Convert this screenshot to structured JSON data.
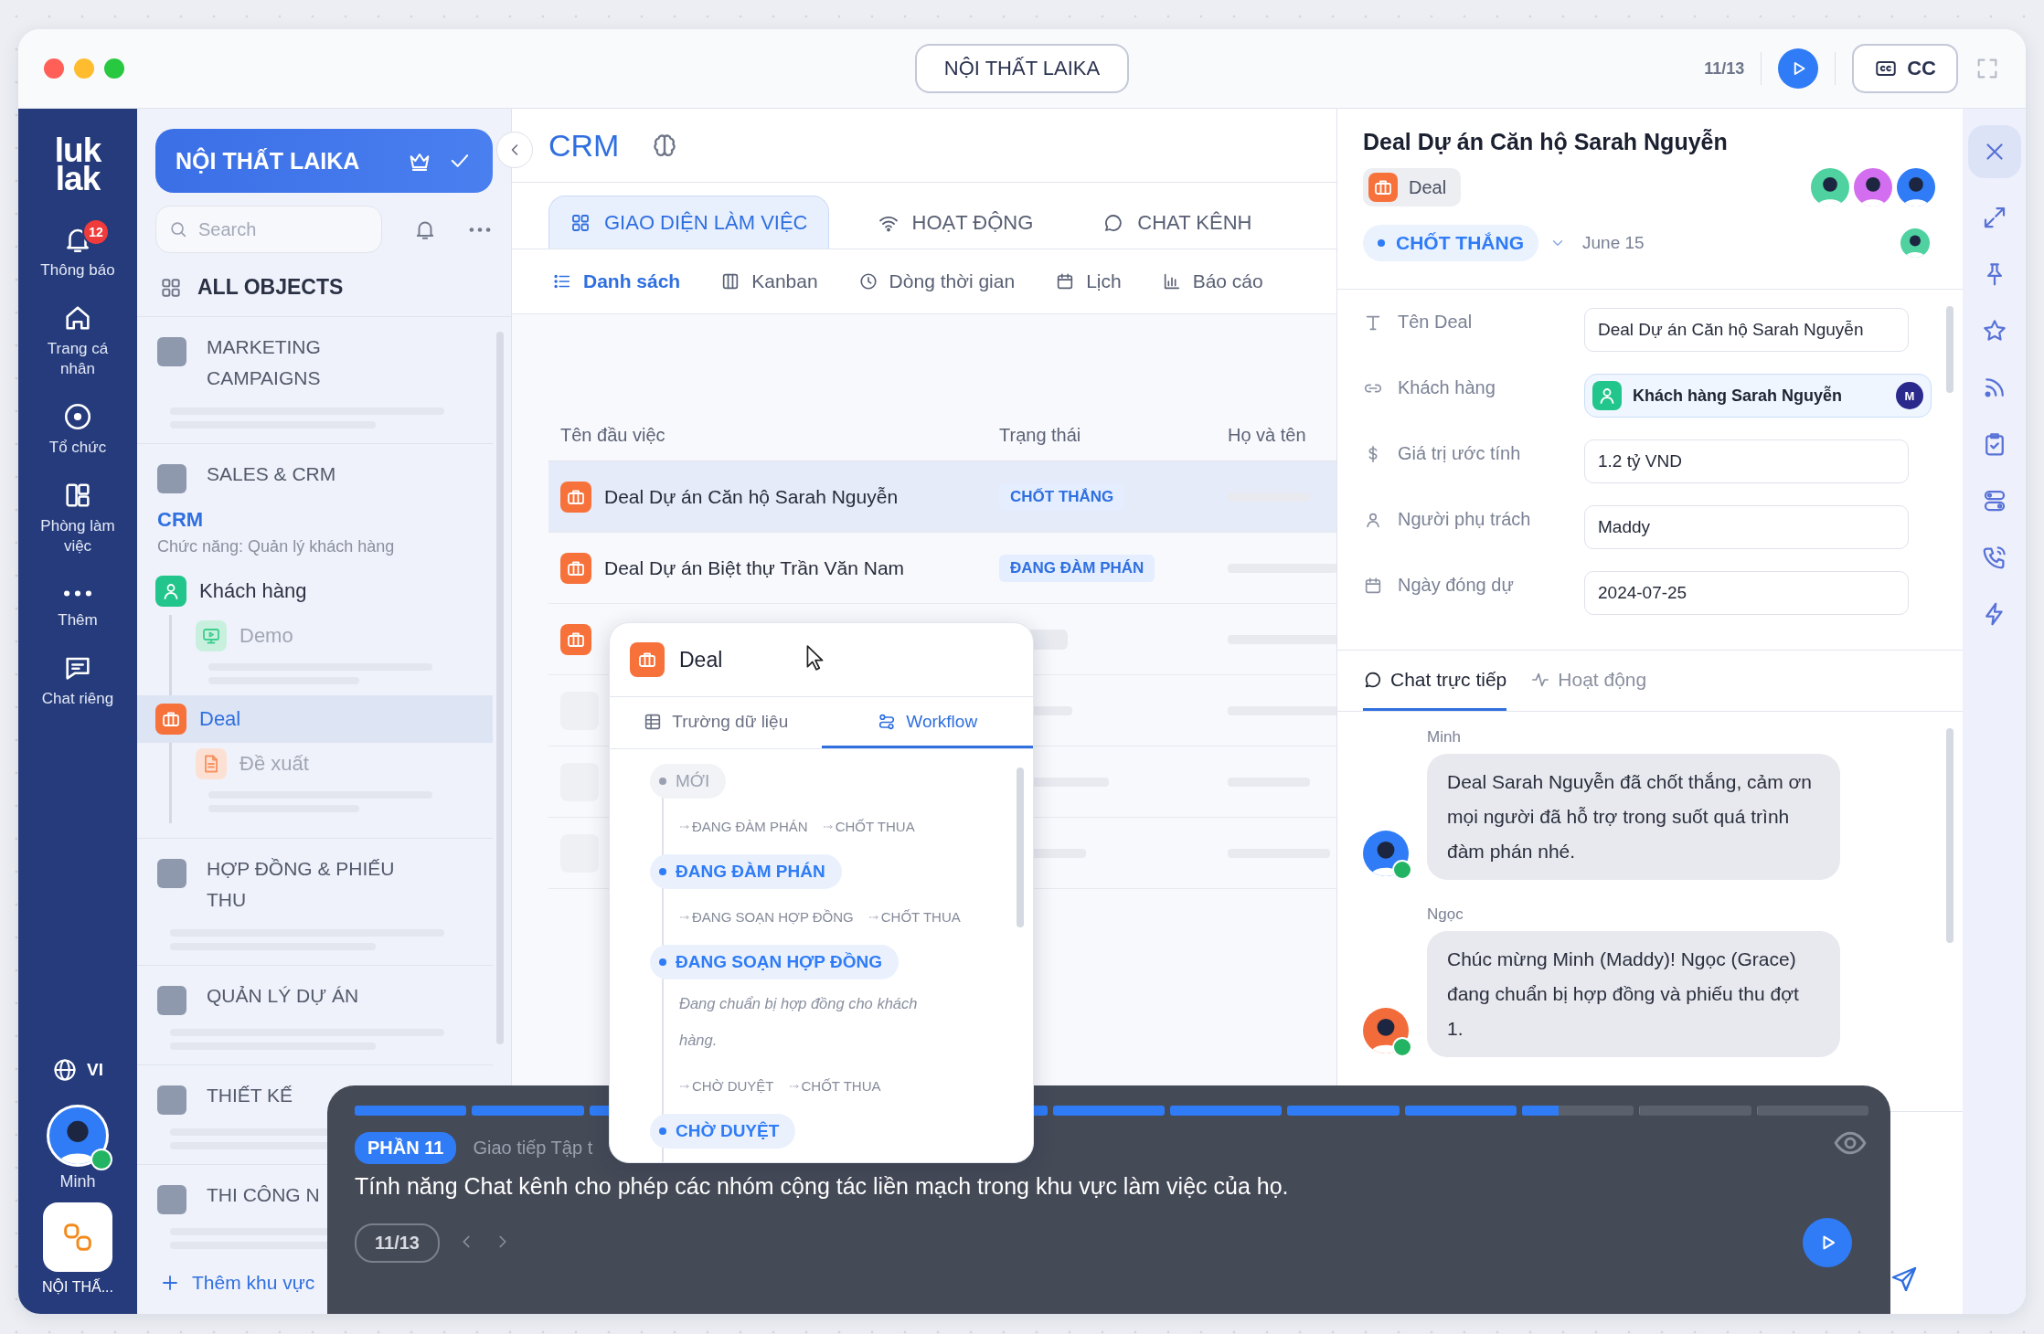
{
  "window": {
    "title": "NỘI THẤT LAIKA",
    "step": "11/13",
    "cc_label": "CC"
  },
  "rail": {
    "logo": [
      "luk",
      "lak"
    ],
    "items": [
      {
        "kind": "bell",
        "label": "Thông báo",
        "badge": "12"
      },
      {
        "kind": "home",
        "label": "Trang cá nhân"
      },
      {
        "kind": "target",
        "label": "Tổ chức"
      },
      {
        "kind": "layout",
        "label": "Phòng làm việc"
      },
      {
        "kind": "dots",
        "label": "Thêm"
      },
      {
        "kind": "chat",
        "label": "Chat riêng"
      }
    ],
    "language": "VI",
    "user": {
      "name": "Minh",
      "online": true,
      "color": "#2f7cf6"
    },
    "app": {
      "label": "NỘI THẤ..."
    }
  },
  "sidebar": {
    "workspace": "NỘI THẤT LAIKA",
    "search": {
      "placeholder": "Search"
    },
    "all_objects": "ALL OBJECTS",
    "sections": [
      {
        "title": "MARKETING CAMPAIGNS"
      },
      {
        "title": "SALES & CRM",
        "module": {
          "name": "CRM",
          "description": "Chức năng: Quản lý khách hàng",
          "objects": [
            {
              "name": "Khách hàng",
              "kind": "customer",
              "selected": false,
              "children": [
                {
                  "name": "Demo",
                  "kind": "demo",
                  "selected": false
                }
              ]
            },
            {
              "name": "Deal",
              "kind": "deal",
              "selected": true,
              "children": [
                {
                  "name": "Đề xuất",
                  "kind": "proposal",
                  "selected": false
                }
              ]
            }
          ]
        }
      },
      {
        "title": "HỢP ĐỒNG & PHIẾU THU"
      },
      {
        "title": "QUẢN LÝ DỰ ÁN"
      },
      {
        "title": "THIẾT KẾ"
      },
      {
        "title": "THI CÔNG N"
      }
    ],
    "add_label": "Thêm khu vực"
  },
  "main": {
    "title": "CRM",
    "tabs": [
      {
        "label": "GIAO DIỆN LÀM VIỆC",
        "kind": "grid",
        "selected": true
      },
      {
        "label": "HOẠT ĐỘNG",
        "kind": "wifi",
        "selected": false
      },
      {
        "label": "CHAT KÊNH",
        "kind": "bubble",
        "selected": false
      }
    ],
    "views": [
      {
        "label": "Danh sách",
        "kind": "list",
        "selected": true
      },
      {
        "label": "Kanban",
        "kind": "kanban",
        "selected": false
      },
      {
        "label": "Dòng thời gian",
        "kind": "clock",
        "selected": false
      },
      {
        "label": "Lịch",
        "kind": "calendar",
        "selected": false
      },
      {
        "label": "Báo cáo",
        "kind": "chart",
        "selected": false
      }
    ],
    "table": {
      "columns": [
        "Tên đầu việc",
        "Trạng thái",
        "Họ và tên"
      ],
      "rows": [
        {
          "kind": "deal",
          "name": "Deal Dự án Căn hộ Sarah Nguyễn",
          "status": "CHỐT THẮNG",
          "selected": true
        },
        {
          "kind": "deal",
          "name": "Deal Dự án Biệt thự Trần Văn Nam",
          "status": "ĐANG ĐÀM PHÁN",
          "selected": false
        },
        {
          "kind": "covered",
          "selected": false
        },
        {
          "kind": "loading",
          "selected": false
        },
        {
          "kind": "loading",
          "selected": false
        },
        {
          "kind": "loading",
          "selected": false
        }
      ]
    }
  },
  "popup": {
    "object": "Deal",
    "tabs": [
      {
        "label": "Trường dữ liệu",
        "kind": "table",
        "selected": false
      },
      {
        "label": "Workflow",
        "kind": "flow",
        "selected": true
      }
    ],
    "stages": [
      {
        "name": "MỚI",
        "active": false,
        "next": [
          "ĐANG ĐÀM PHÁN",
          "CHỐT THUA"
        ]
      },
      {
        "name": "ĐANG ĐÀM PHÁN",
        "active": true,
        "next": [
          "ĐANG SOẠN HỢP ĐỒNG",
          "CHỐT THUA"
        ]
      },
      {
        "name": "ĐANG SOẠN HỢP ĐỒNG",
        "active": true,
        "description": "Đang chuẩn bị hợp đồng cho khách hàng.",
        "next": [
          "CHỜ DUYỆT",
          "CHỐT THUA"
        ]
      },
      {
        "name": "CHỜ DUYỆT",
        "active": true
      }
    ]
  },
  "detail": {
    "title": "Deal Dự án Căn hộ Sarah Nguyễn",
    "type": "Deal",
    "status": "CHỐT THẮNG",
    "date": "June 15",
    "members": [
      {
        "color": "#4fd1a0"
      },
      {
        "color": "#d46ef0"
      },
      {
        "color": "#2f7cf6"
      }
    ],
    "fields": [
      {
        "kind": "text",
        "label": "Tên Deal",
        "value": "Deal Dự án Căn hộ Sarah Nguyễn"
      },
      {
        "kind": "link",
        "label": "Khách hàng",
        "value": "Khách hàng Sarah Nguyễn",
        "badge": "M"
      },
      {
        "kind": "money",
        "label": "Giá trị ước tính",
        "value": "1.2 tỷ VND"
      },
      {
        "kind": "person",
        "label": "Người phụ trách",
        "value": "Maddy"
      },
      {
        "kind": "date",
        "label": "Ngày đóng dự",
        "value": "2024-07-25"
      }
    ],
    "chat_tabs": [
      {
        "label": "Chat trực tiếp",
        "kind": "bubble",
        "selected": true
      },
      {
        "label": "Hoạt động",
        "kind": "activity",
        "selected": false
      }
    ],
    "messages": [
      {
        "author": "Minh",
        "text": "Deal Sarah Nguyễn đã chốt thắng, cảm ơn mọi người đã hỗ trợ trong suốt quá trình đàm phán nhé.",
        "online": true,
        "color": "#2f7cf6"
      },
      {
        "author": "Ngọc",
        "text": "Chúc mừng Minh (Maddy)! Ngọc (Grace) đang chuẩn bị hợp đồng và phiếu thu đợt 1.",
        "online": true,
        "color": "#f26b3a"
      }
    ]
  },
  "tour": {
    "segments": [
      {
        "level": 1
      },
      {
        "level": 1
      },
      {
        "level": 1
      },
      {
        "level": 1
      },
      {
        "level": 1
      },
      {
        "level": 1
      },
      {
        "level": 1
      },
      {
        "level": 1
      },
      {
        "level": 0.33
      },
      {
        "level": 0
      },
      {
        "level": 0
      }
    ],
    "part": "PHẦN 11",
    "topic": "Giao tiếp Tập t",
    "text": "Tính năng Chat kênh cho phép các nhóm cộng tác liền mạch trong khu vực làm việc của họ.",
    "counter": "11/13"
  }
}
